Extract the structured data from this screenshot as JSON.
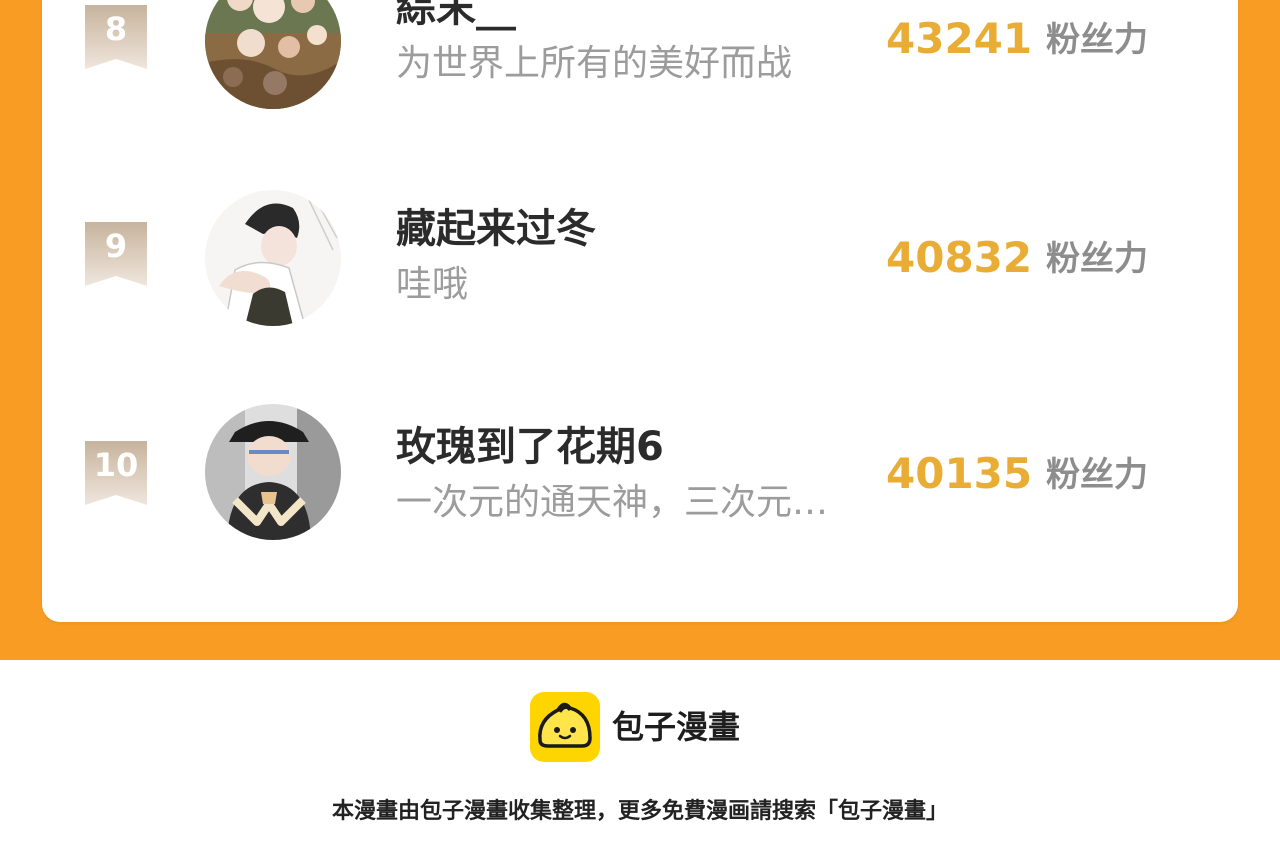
{
  "colors": {
    "band": "#f99c24",
    "score": "#e9ad35",
    "badge_top": "#c7b39d",
    "badge_bottom": "#efe6dc"
  },
  "ranking": [
    {
      "rank": "8",
      "name": "綜末__",
      "bio": "为世界上所有的美好而战",
      "score": "43241",
      "unit": "粉丝力",
      "avatar": "cotton-flower-avatar"
    },
    {
      "rank": "9",
      "name": "藏起来过冬",
      "bio": "哇哦",
      "score": "40832",
      "unit": "粉丝力",
      "avatar": "sketch-couple-avatar"
    },
    {
      "rank": "10",
      "name": "玫瑰到了花期6",
      "bio": "一次元的通天神，三次元…",
      "score": "40135",
      "unit": "粉丝力",
      "avatar": "boy-with-hat-avatar"
    }
  ],
  "footer": {
    "brand": "包子漫畫",
    "note": "本漫畫由包子漫畫收集整理，更多免費漫画請搜索「包子漫畫」",
    "logo_icon": "bun-face-icon"
  }
}
